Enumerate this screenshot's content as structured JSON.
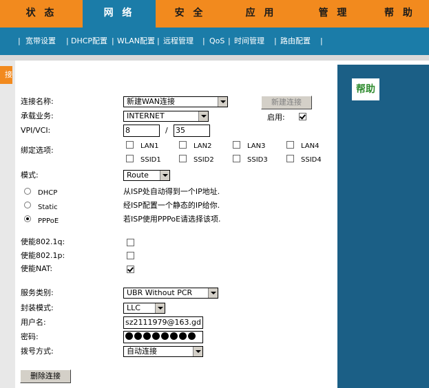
{
  "topnav": {
    "tabs": [
      {
        "label": "状 态"
      },
      {
        "label": "网 络"
      },
      {
        "label": "安 全"
      },
      {
        "label": "应 用"
      },
      {
        "label": "管 理"
      },
      {
        "label": "帮 助"
      }
    ],
    "active_index": 1
  },
  "subnav": {
    "items": [
      "宽带设置",
      "DHCP配置",
      "WLAN配置",
      "远程管理",
      "QoS",
      "时间管理",
      "路由配置"
    ],
    "separator": "|"
  },
  "left_tab_label": "接",
  "form": {
    "connection_name": {
      "label": "连接名称:",
      "value": "新建WAN连接"
    },
    "new_connection_button": "新建连接",
    "service": {
      "label": "承载业务:",
      "value": "INTERNET"
    },
    "enable": {
      "label": "启用:",
      "checked": true
    },
    "vpi_vci": {
      "label": "VPI/VCI:",
      "vpi": "8",
      "separator": "/",
      "vci": "35"
    },
    "binding": {
      "label": "绑定选项:",
      "options": [
        {
          "label": "LAN1",
          "checked": false
        },
        {
          "label": "LAN2",
          "checked": false
        },
        {
          "label": "LAN3",
          "checked": false
        },
        {
          "label": "LAN4",
          "checked": false
        },
        {
          "label": "SSID1",
          "checked": false
        },
        {
          "label": "SSID2",
          "checked": false
        },
        {
          "label": "SSID3",
          "checked": false
        },
        {
          "label": "SSID4",
          "checked": false
        }
      ]
    },
    "mode": {
      "label": "模式:",
      "value": "Route"
    },
    "ip_modes": [
      {
        "label": "DHCP",
        "desc": "从ISP处自动得到一个IP地址.",
        "selected": false
      },
      {
        "label": "Static",
        "desc": "经ISP配置一个静态的IP给你.",
        "selected": false
      },
      {
        "label": "PPPoE",
        "desc": "若ISP使用PPPoE请选择该项.",
        "selected": true
      }
    ],
    "enable_8021q": {
      "label": "使能802.1q:",
      "checked": false
    },
    "enable_8021p": {
      "label": "使能802.1p:",
      "checked": false
    },
    "enable_nat": {
      "label": "使能NAT:",
      "checked": true
    },
    "service_class": {
      "label": "服务类别:",
      "value": "UBR Without PCR"
    },
    "encapsulation": {
      "label": "封装模式:",
      "value": "LLC"
    },
    "username": {
      "label": "用户名:",
      "value": "sz2111979@163.gd"
    },
    "password": {
      "label": "密码:",
      "length": 8
    },
    "dial_mode": {
      "label": "拨号方式:",
      "value": "自动连接"
    },
    "delete_button": "删除连接"
  },
  "help": {
    "title": "帮助"
  },
  "colors": {
    "orange": "#f28a1e",
    "blue": "#1b7ca8",
    "help_bg": "#1b5f86",
    "help_title": "#2f8b2f"
  }
}
